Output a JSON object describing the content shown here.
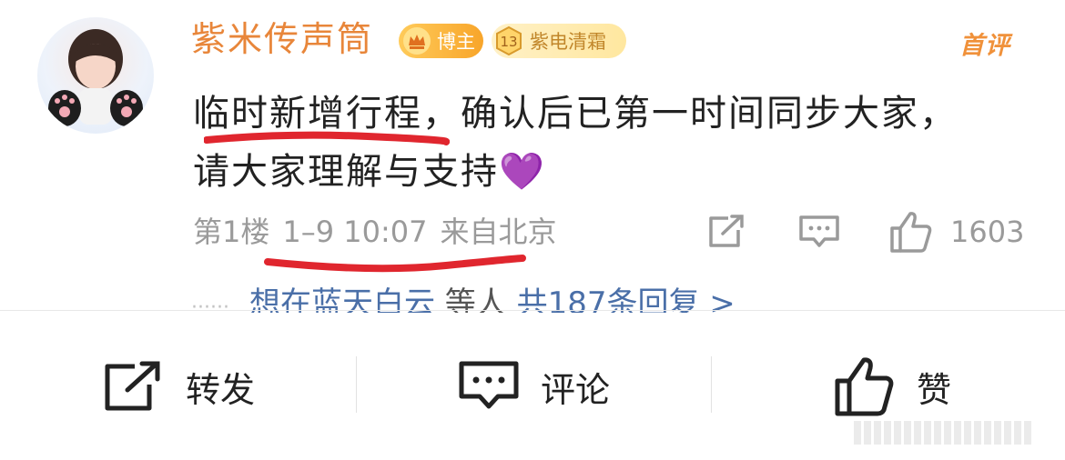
{
  "comment": {
    "username": "紫米传声筒",
    "badge_level_label": "博主",
    "badge_fan_number": "13",
    "badge_fan_label": "紫电清霜",
    "first_comment_label": "首评",
    "content_line1": "临时新增行程，确认后已第一时间同步大家，",
    "content_line2": "请大家理解与支持",
    "content_emoji": "💜",
    "floor": "第1楼",
    "timestamp": "1–9 10:07",
    "location": "来自北京",
    "like_count": "1603",
    "replies_dots": "······",
    "replies_preview": "想在蓝天白云",
    "replies_suffix": "等人",
    "replies_total": "共187条回复 >"
  },
  "bottom_bar": {
    "repost_label": "转发",
    "comment_label": "评论",
    "like_label": "赞"
  },
  "colors": {
    "username": "#e8863a",
    "underline": "#e0262e",
    "link": "#4a6fa8",
    "muted": "#9a9a9a"
  },
  "icons": [
    "repost-icon",
    "comment-icon",
    "thumbs-up-icon"
  ]
}
